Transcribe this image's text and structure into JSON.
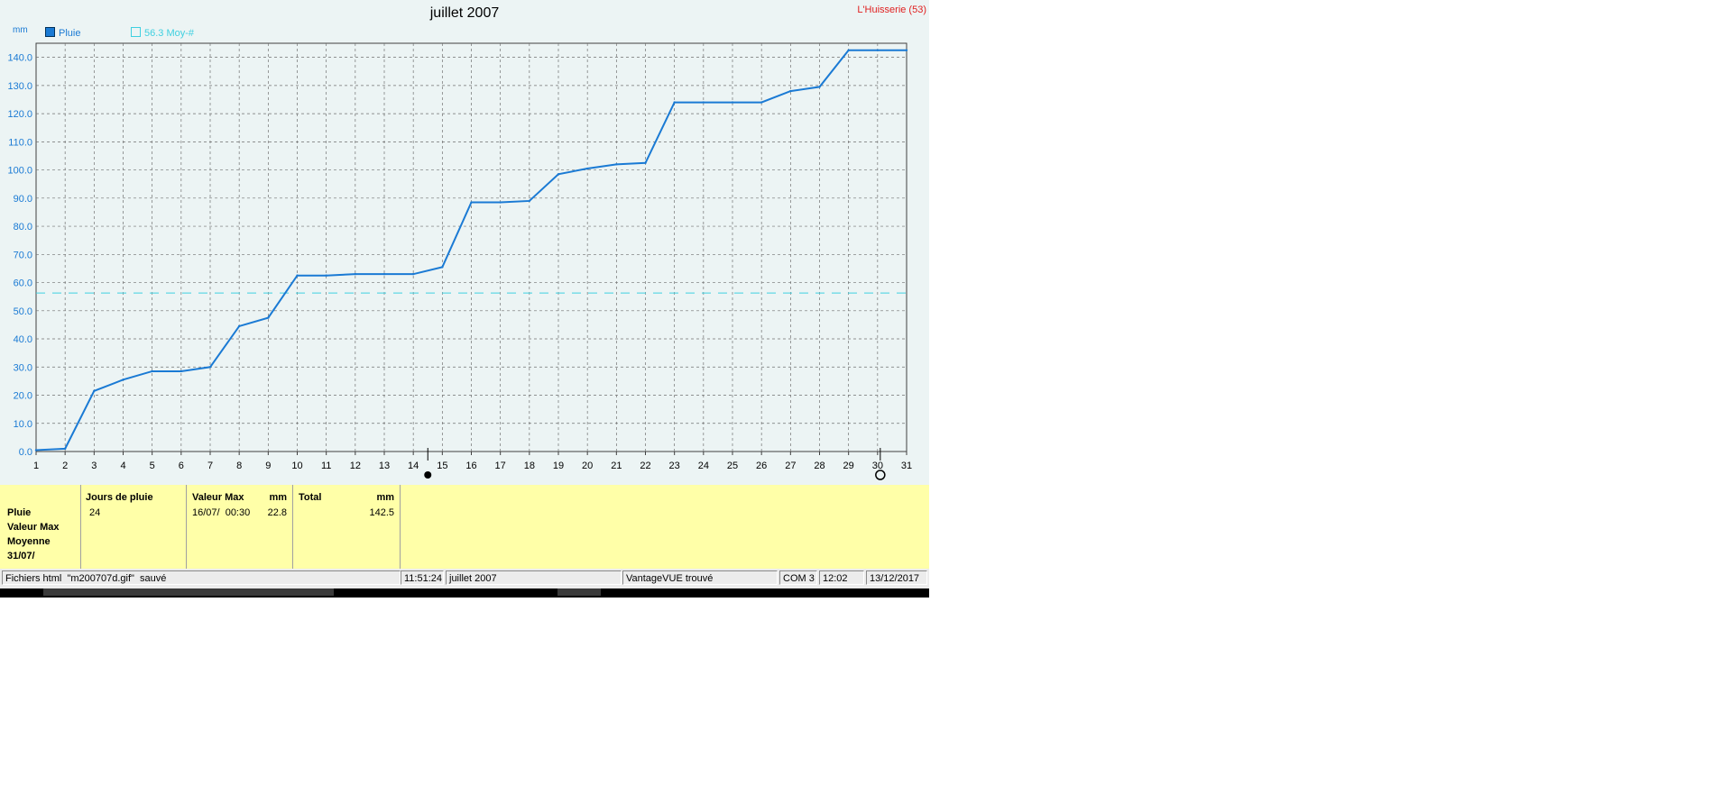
{
  "chart": {
    "title": "juillet 2007",
    "station": "L'Huisserie (53)",
    "unit": "mm",
    "legend_rain": "Pluie",
    "legend_avg": "56.3 Moy-#",
    "rain_color": "#1a7ad4",
    "avg_color": "#3fd0e0"
  },
  "chart_data": {
    "type": "line",
    "title": "juillet 2007",
    "ylabel": "mm",
    "xlim": [
      1,
      31
    ],
    "ylim": [
      0,
      145
    ],
    "grid": true,
    "legend_position": "top-left",
    "x_ticks": [
      1,
      2,
      3,
      4,
      5,
      6,
      7,
      8,
      9,
      10,
      11,
      12,
      13,
      14,
      15,
      16,
      17,
      18,
      19,
      20,
      21,
      22,
      23,
      24,
      25,
      26,
      27,
      28,
      29,
      30,
      31
    ],
    "y_ticks": [
      "0.0",
      "10.0",
      "20.0",
      "30.0",
      "40.0",
      "50.0",
      "60.0",
      "70.0",
      "80.0",
      "90.0",
      "100.0",
      "110.0",
      "120.0",
      "130.0",
      "140.0"
    ],
    "series": [
      {
        "name": "Pluie",
        "x": [
          1,
          2,
          3,
          4,
          5,
          6,
          7,
          8,
          9,
          10,
          11,
          12,
          13,
          14,
          15,
          16,
          17,
          18,
          19,
          20,
          21,
          22,
          23,
          24,
          25,
          26,
          27,
          28,
          29,
          30,
          31
        ],
        "values": [
          0.5,
          1.0,
          21.5,
          25.5,
          28.5,
          28.5,
          30.0,
          44.5,
          47.5,
          62.5,
          62.5,
          63.0,
          63.0,
          63.0,
          65.5,
          88.5,
          88.5,
          89.0,
          98.5,
          100.5,
          102.0,
          102.5,
          124.0,
          124.0,
          124.0,
          124.0,
          128.0,
          129.5,
          142.5,
          142.5,
          142.5
        ]
      },
      {
        "name": "56.3 Moy-#",
        "x": [
          1,
          31
        ],
        "values": [
          56.3,
          56.3
        ]
      }
    ]
  },
  "summary": {
    "row_labels": [
      "Pluie",
      "Valeur Max",
      "Moyenne",
      "31/07/"
    ],
    "jours_header": "Jours de pluie",
    "jours_value": "24",
    "max_header": "Valeur Max",
    "max_unit": "mm",
    "max_date": "16/07/  00:30",
    "max_value": "22.8",
    "total_header": "Total",
    "total_unit": "mm",
    "total_value": "142.5"
  },
  "status": {
    "message": "Fichiers html  \"m200707d.gif\"  sauvé",
    "time1": "11:51:24",
    "period": "juillet 2007",
    "device": "VantageVUE trouvé",
    "port": "COM 3",
    "time2": "12:02",
    "date": "13/12/2017"
  }
}
